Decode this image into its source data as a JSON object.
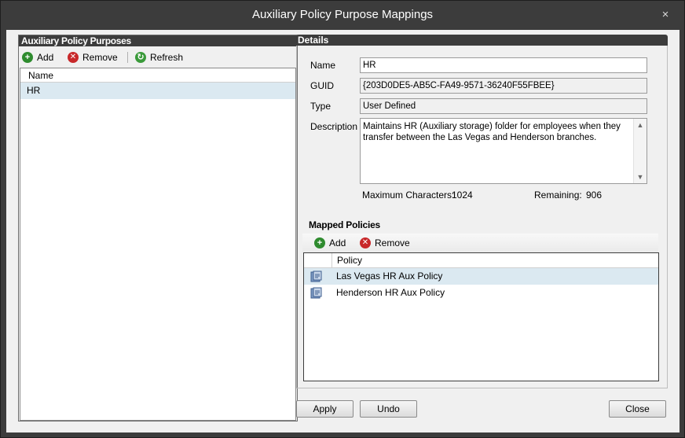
{
  "window": {
    "title": "Auxiliary Policy Purpose Mappings",
    "close_glyph": "×"
  },
  "purposes_panel": {
    "header": "Auxiliary Policy Purposes",
    "toolbar": {
      "add": {
        "label": "Add",
        "icon": "add-icon"
      },
      "remove": {
        "label": "Remove",
        "icon": "remove-icon"
      },
      "refresh": {
        "label": "Refresh",
        "icon": "refresh-icon"
      }
    },
    "column_header": "Name",
    "items": [
      {
        "name": "HR"
      }
    ]
  },
  "details": {
    "header": "Details",
    "name_label": "Name",
    "name_value": "HR",
    "guid_label": "GUID",
    "guid_value": "{203D0DE5-AB5C-FA49-9571-36240F55FBEE}",
    "type_label": "Type",
    "type_value": "User Defined",
    "description_label": "Description",
    "description_value": "Maintains HR (Auxiliary storage) folder for employees when they transfer between the Las Vegas and Henderson branches.",
    "max_chars_label": "Maximum Characters:",
    "max_chars_value": "1024",
    "remaining_label": "Remaining:",
    "remaining_value": "906"
  },
  "mapped_policies": {
    "title": "Mapped Policies",
    "toolbar": {
      "add": {
        "label": "Add",
        "icon": "add-icon"
      },
      "remove": {
        "label": "Remove",
        "icon": "remove-icon"
      }
    },
    "column_header": "Policy",
    "rows": [
      {
        "name": "Las Vegas HR Aux Policy",
        "icon": "policy-icon"
      },
      {
        "name": "Henderson HR Aux Policy",
        "icon": "policy-icon"
      }
    ]
  },
  "buttons": {
    "apply": "Apply",
    "undo": "Undo",
    "close": "Close"
  },
  "colors": {
    "frame": "#3c3c3c",
    "client_bg": "#f0f0f0",
    "selection": "#dbe9f1",
    "add_green": "#2e8b2e",
    "remove_red": "#c8282a"
  }
}
